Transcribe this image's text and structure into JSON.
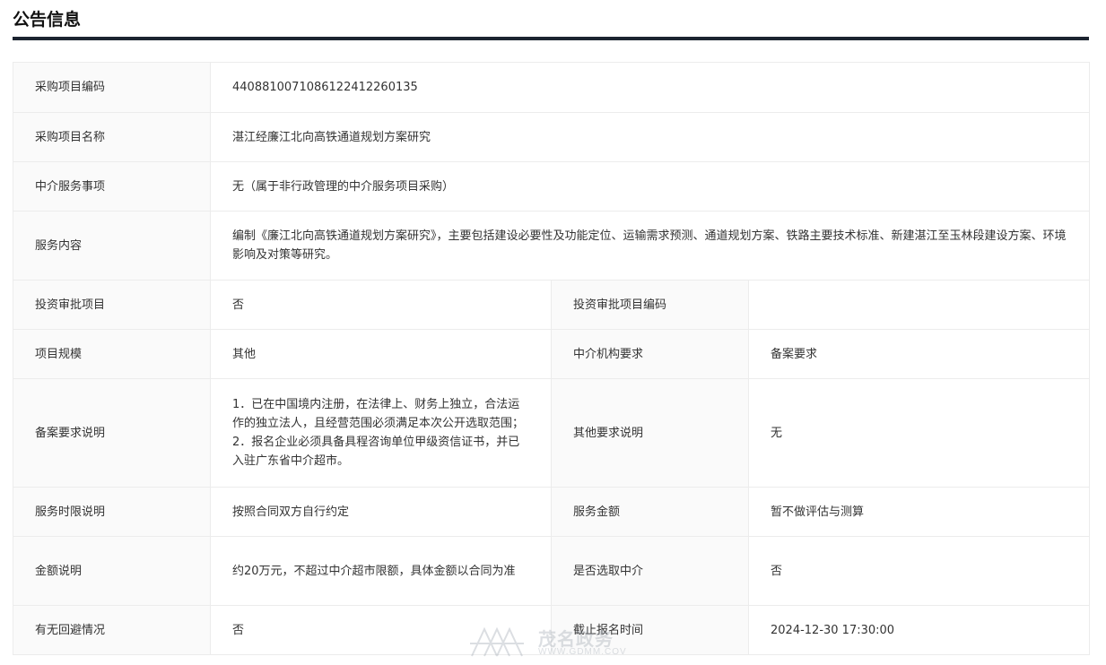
{
  "section": {
    "title": "公告信息"
  },
  "rows": [
    {
      "type": "full",
      "label": "采购项目编码",
      "value": "440881007108612241226013​5"
    },
    {
      "type": "full",
      "label": "采购项目名称",
      "value": "湛江经廉江北向高铁通道规划方案研究"
    },
    {
      "type": "full",
      "label": "中介服务事项",
      "value": "无（属于非行政管理的中介服务项目采购）"
    },
    {
      "type": "full",
      "label": "服务内容",
      "value": "编制《廉江北向高铁通道规划方案研究》，主要包括建设必要性及功能定位、运输需求预测、通道规划方案、铁路主要技术标准、新建湛江至玉林段建设方案、环境影响及对策等研究。"
    },
    {
      "type": "split",
      "label1": "投资审批项目",
      "value1": "否",
      "label2": "投资审批项目编码",
      "value2": ""
    },
    {
      "type": "split",
      "label1": "项目规模",
      "value1": "其他",
      "label2": "中介机构要求",
      "value2": "备案要求"
    },
    {
      "type": "split",
      "label1": "备案要求说明",
      "value1": "1．已在中国境内注册，在法律上、财务上独立，合法运作的独立法人，且经营范围必须满足本次公开选取范围； 2．报名企业必须具备具程咨询单位甲级资信证书，并已入驻广东省中介超市。",
      "label2": "其他要求说明",
      "value2": "无"
    },
    {
      "type": "split",
      "label1": "服务时限说明",
      "value1": "按照合同双方自行约定",
      "label2": "服务金额",
      "value2": "暂不做评估与测算"
    },
    {
      "type": "split",
      "label1": "金额说明",
      "value1": "约20万元，不超过中介超市限额，具体金额以合同为准",
      "label2": "是否选取中介",
      "value2": "否"
    },
    {
      "type": "split",
      "label1": "有无回避情况",
      "value1": "否",
      "label2": "截止报名时间",
      "value2": "2024-12-30 17:30:00"
    }
  ],
  "watermark": {
    "text": "茂名政务",
    "url": "WWW.GDMM.COV"
  }
}
